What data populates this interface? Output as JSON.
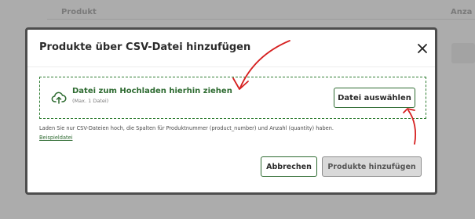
{
  "background": {
    "column_left": "Produkt",
    "column_right": "Anza"
  },
  "modal": {
    "title": "Produkte über CSV-Datei hinzufügen",
    "close_icon": "close-icon",
    "dropzone": {
      "icon": "upload-cloud-icon",
      "title": "Datei zum Hochladen hierhin ziehen",
      "subtitle": "(Max. 1 Datei)",
      "choose_button": "Datei auswählen"
    },
    "hint": "Laden Sie nur CSV-Dateien hoch, die Spalten für Produktnummer (product_number) und Anzahl (quantity) haben.",
    "example_link": "Beispieldatei",
    "cancel_button": "Abbrechen",
    "submit_button": "Produkte hinzufügen"
  },
  "colors": {
    "accent_green": "#2e6b31",
    "annotation_red": "#d62020"
  }
}
